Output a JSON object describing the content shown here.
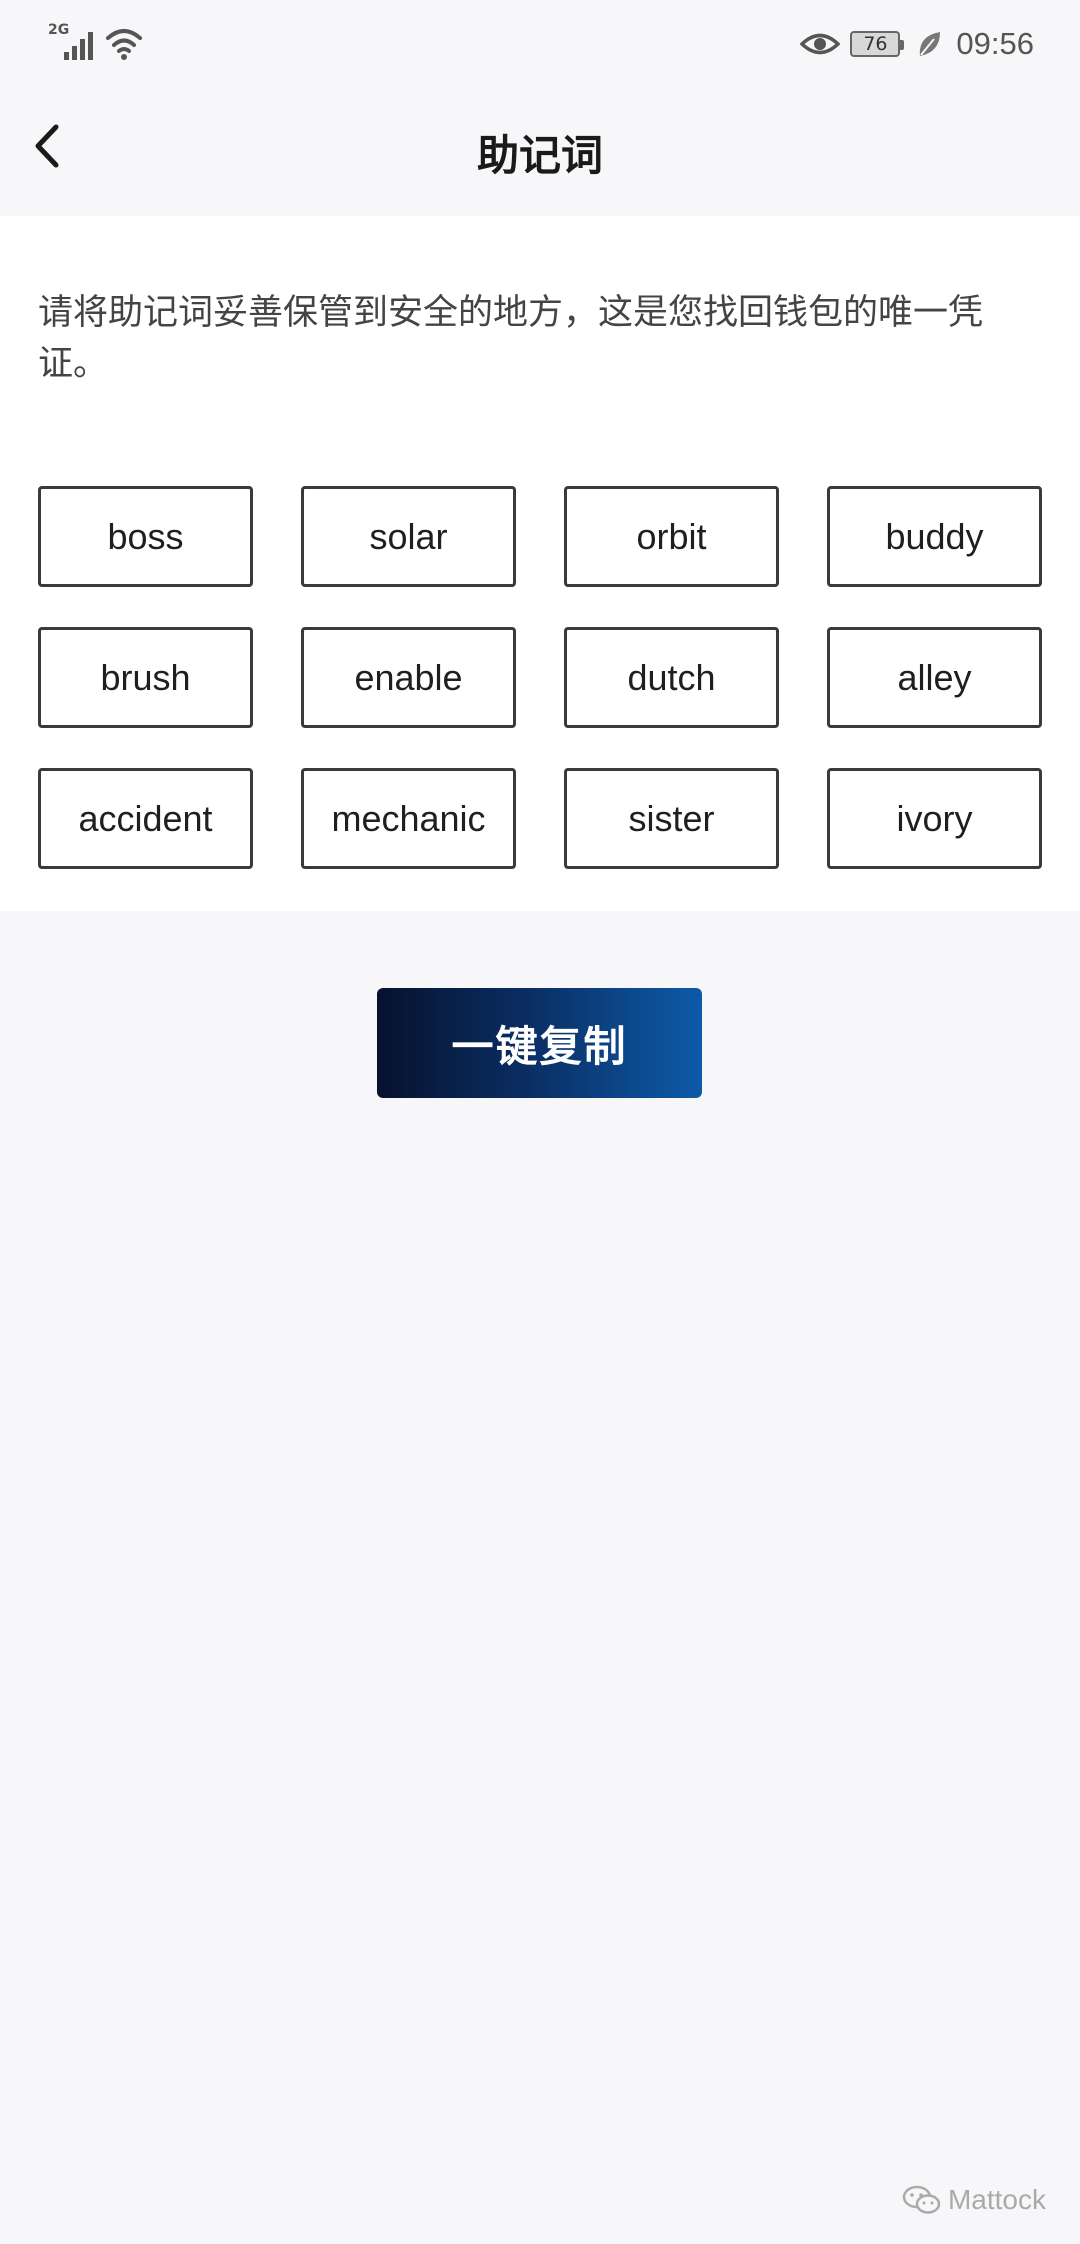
{
  "status_bar": {
    "network_type": "2G",
    "battery_level": "76",
    "time": "09:56",
    "icons": [
      "signal-icon",
      "wifi-icon",
      "eye-icon",
      "battery-icon",
      "leaf-icon"
    ]
  },
  "nav": {
    "back_icon": "chevron-left-icon",
    "title": "助记词"
  },
  "notice": "请将助记词妥善保管到安全的地方，这是您找回钱包的唯一凭证。",
  "words": [
    "boss",
    "solar",
    "orbit",
    "buddy",
    "brush",
    "enable",
    "dutch",
    "alley",
    "accident",
    "mechanic",
    "sister",
    "ivory"
  ],
  "copy_button_label": "一键复制",
  "watermark": {
    "icon": "wechat-icon",
    "text": "Mattock"
  },
  "colors": {
    "background": "#f7f7f9",
    "card": "#ffffff",
    "button_start": "#06122e",
    "button_end": "#0d5aa8"
  }
}
